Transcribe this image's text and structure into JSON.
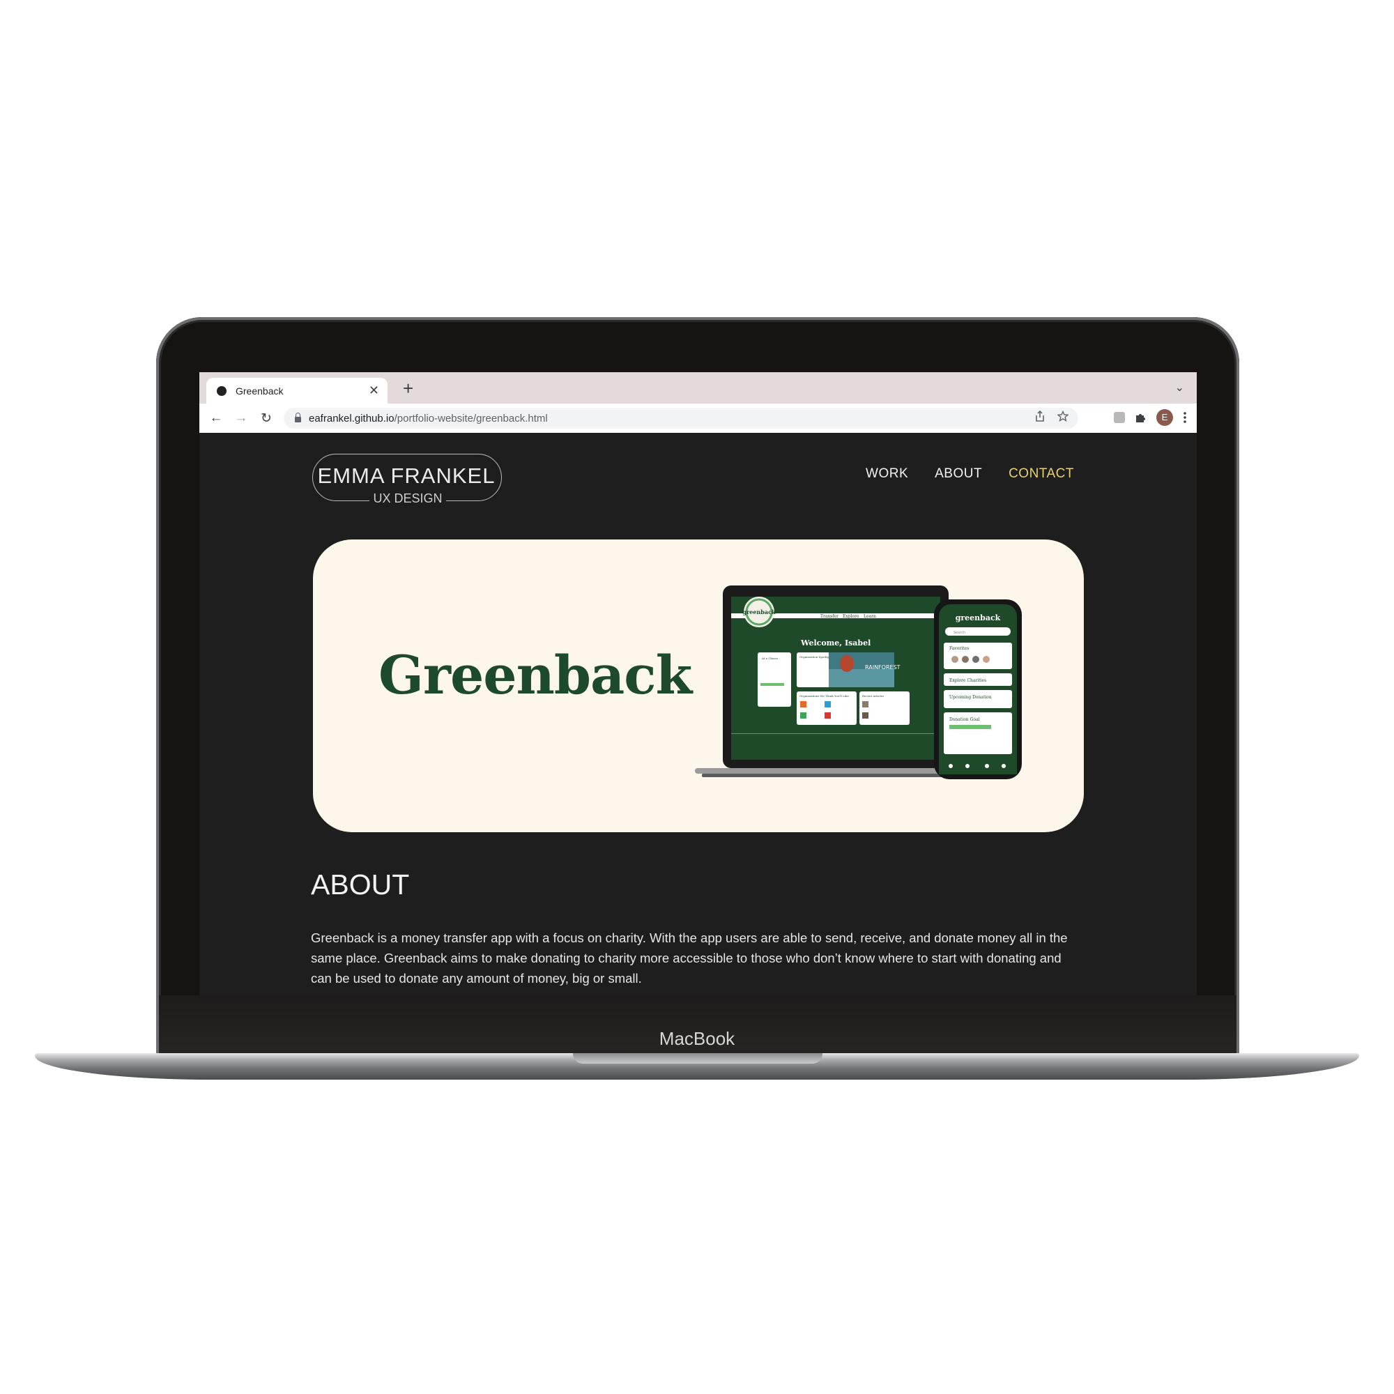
{
  "device": {
    "label": "MacBook"
  },
  "browser": {
    "tab": {
      "title": "Greenback",
      "close": "✕"
    },
    "new_tab": "+",
    "tab_list": "⌄",
    "nav": {
      "back": "←",
      "forward": "→",
      "reload": "↻"
    },
    "url": {
      "host": "eafrankel.github.io",
      "path": "/portfolio-website/greenback.html"
    },
    "profile_initial": "E"
  },
  "site": {
    "logo": {
      "name": "EMMA FRANKEL",
      "subtitle": "UX DESIGN"
    },
    "nav": [
      {
        "label": "WORK"
      },
      {
        "label": "ABOUT"
      },
      {
        "label": "CONTACT"
      }
    ],
    "hero": {
      "title": "Greenback",
      "mockup": {
        "web_logo": "greenback",
        "web_nav": [
          "Transfer",
          "Explore",
          "Learn"
        ],
        "welcome": "Welcome, Isabel",
        "panels": [
          "At a Glance",
          "Organization Spotlight",
          "Organizations We Think You'll Like",
          "Recent Articles"
        ],
        "banner": "RAINFOREST",
        "phone_logo": "greenback",
        "phone_search": "Search",
        "phone_sections": [
          "Favorites",
          "Explore Charities",
          "Upcoming Donation",
          "Donation Goal"
        ]
      }
    },
    "about": {
      "heading": "ABOUT",
      "text": "Greenback is a money transfer app with a focus on charity. With the app users are able to send, receive, and donate money all in the same place. Greenback aims to make donating to charity more accessible to those who don’t know where to start with donating and can be used to donate any amount of money, big or small."
    }
  },
  "colors": {
    "page_bg": "#1e1e1e",
    "hero_bg": "#fdf6ea",
    "brand_green": "#1d4a2c",
    "nav_active": "#e7d271"
  }
}
